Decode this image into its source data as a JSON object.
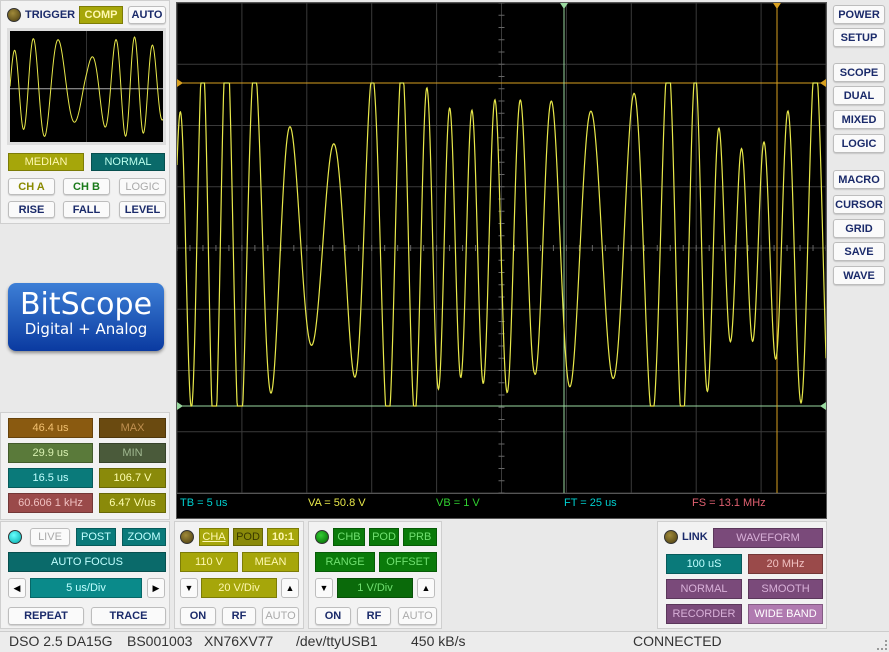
{
  "trigger": {
    "label": "TRIGGER",
    "comp": "COMP",
    "auto": "AUTO",
    "median": "MEDIAN",
    "normal": "NORMAL",
    "cha": "CH A",
    "chb": "CH B",
    "logic": "LOGIC",
    "rise": "RISE",
    "fall": "FALL",
    "level": "LEVEL"
  },
  "logo": {
    "title": "BitScope",
    "subtitle": "Digital + Analog"
  },
  "measurements": {
    "row1": [
      "46.4 us",
      "MAX"
    ],
    "row2": [
      "29.9 us",
      "MIN"
    ],
    "row3": [
      "16.5 us",
      "106.7 V"
    ],
    "row4": [
      "60.606 1 kHz",
      "6.47 V/us"
    ]
  },
  "right_menu": [
    "POWER",
    "SETUP",
    "SCOPE",
    "DUAL",
    "MIXED",
    "LOGIC",
    "MACRO",
    "CURSOR",
    "GRID",
    "SAVE",
    "WAVE"
  ],
  "readout": {
    "tb": "TB = 5 us",
    "va": "VA = 50.8 V",
    "vb": "VB = 1 V",
    "ft": "FT = 25 us",
    "fs": "FS = 13.1 MHz"
  },
  "timebase": {
    "live": "LIVE",
    "post": "POST",
    "zoom": "ZOOM",
    "autofocus": "AUTO FOCUS",
    "value": "5 us/Div",
    "repeat": "REPEAT",
    "trace": "TRACE"
  },
  "cha": {
    "label": "CHA",
    "pod": "POD",
    "ratio": "10:1",
    "range": "110 V",
    "mean": "MEAN",
    "value": "20 V/Div",
    "on": "ON",
    "rf": "RF",
    "auto": "AUTO"
  },
  "chb": {
    "label": "CHB",
    "pod": "POD",
    "prb": "PRB",
    "range": "RANGE",
    "offset": "OFFSET",
    "value": "1 V/Div",
    "on": "ON",
    "rf": "RF",
    "auto": "AUTO"
  },
  "link": {
    "label": "LINK",
    "waveform": "WAVEFORM",
    "duration": "100 uS",
    "bandwidth": "20 MHz",
    "normal": "NORMAL",
    "smooth": "SMOOTH",
    "recorder": "RECORDER",
    "wideband": "WIDE BAND"
  },
  "status_bar": {
    "model": "DSO 2.5 DA15G",
    "serial": "BS001003",
    "id": "XN76XV77",
    "device": "/dev/ttyUSB1",
    "rate": "450 kB/s",
    "state": "CONNECTED"
  },
  "colors": {
    "trace": "#e8e84a",
    "grid": "#3a3a3a",
    "cursor_green": "#9ad9a0",
    "cursor_orange": "#d8a020",
    "tile_olive": "#a6a60a",
    "tile_teal": "#0a7a7a",
    "tile_brown": "#8a5a10",
    "tile_purple": "#7a4a7a",
    "tile_green": "#0a7a0a"
  }
}
